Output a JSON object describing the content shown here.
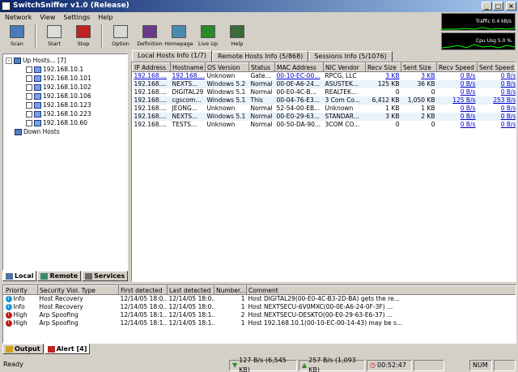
{
  "window": {
    "title": "SwitchSniffer v1.0 (Release)"
  },
  "menu": [
    "Network",
    "View",
    "Settings",
    "Help"
  ],
  "toolbar": [
    {
      "label": "Scan",
      "icon": "scan-icon",
      "color": "#4a7ab8"
    },
    {
      "label": "Start",
      "icon": "start-icon",
      "color": "#dcdcdc"
    },
    {
      "label": "Stop",
      "icon": "stop-icon",
      "color": "#c02020"
    },
    {
      "label": "Option",
      "icon": "option-icon",
      "color": "#d8d8d8"
    },
    {
      "label": "Definition",
      "icon": "definition-icon",
      "color": "#6a3a8a"
    },
    {
      "label": "Homepage",
      "icon": "homepage-icon",
      "color": "#4a8ab0"
    },
    {
      "label": "Live Up",
      "icon": "live-up-icon",
      "color": "#2a8a2a"
    },
    {
      "label": "Help",
      "icon": "help-icon",
      "color": "#3a6a3a"
    }
  ],
  "monitors": {
    "traffic": "Traffic 0.4 kB/s",
    "cpu": "Cpu Usg 5.0 %"
  },
  "tree": {
    "up_hosts": "Up Hosts... [7]",
    "hosts": [
      "192.168.10.1",
      "192.168.10.101",
      "192.168.10.102",
      "192.168.10.106",
      "192.168.10.123",
      "192.168.10.223",
      "192.168.10.60"
    ],
    "down_hosts": "Down Hosts"
  },
  "left_tabs": [
    "Local",
    "Remote",
    "Services"
  ],
  "right_tabs": [
    "Local Hosts Info (1/7)",
    "Remote Hosts Info (5/868)",
    "Sessions Info (5/1076)"
  ],
  "host_table": {
    "columns": [
      "IP Address",
      "Hostname",
      "OS Version",
      "Status",
      "MAC Address",
      "NIC Vendor",
      "Recv Size",
      "Sent Size",
      "Recv Speed",
      "Sent Speed"
    ],
    "rows": [
      [
        "192.168....",
        "192.168....",
        "Unknown",
        "Gate...",
        "00-10-EC-00...",
        "RPCG, LLC",
        "3 KB",
        "3 KB",
        "0 B/s",
        "0 B/s"
      ],
      [
        "192.168....",
        "NEXTS...",
        "Windows 5.2",
        "Normal",
        "00-0E-A6-24...",
        "ASUSTEK...",
        "125 KB",
        "36 KB",
        "0 B/s",
        "0 B/s"
      ],
      [
        "192.168....",
        "DIGITAL29",
        "Windows 5.1",
        "Normal",
        "00-E0-4C-B...",
        "REALTEK...",
        "0",
        "0",
        "0 B/s",
        "0 B/s"
      ],
      [
        "192.168....",
        "cgscom...",
        "Windows 5.1",
        "This",
        "00-04-76-E3...",
        "3 Com Co...",
        "6,412 KB",
        "1,050 KB",
        "125 B/s",
        "253 B/s"
      ],
      [
        "192.168....",
        "JEONG...",
        "Unknown",
        "Normal",
        "52-54-00-EB...",
        "Unknown",
        "1 KB",
        "1 KB",
        "0 B/s",
        "0 B/s"
      ],
      [
        "192.168....",
        "NEXTS...",
        "Windows 5.1",
        "Normal",
        "00-E0-29-63...",
        "STANDAR...",
        "3 KB",
        "2 KB",
        "0 B/s",
        "0 B/s"
      ],
      [
        "192.168....",
        "TESTS...",
        "Unknown",
        "Normal",
        "00-50-DA-90...",
        "3COM CO...",
        "0",
        "0",
        "0 B/s",
        "0 B/s"
      ]
    ]
  },
  "alert_table": {
    "columns": [
      "Priority",
      "Security Viol. Type",
      "First detected",
      "Last detected",
      "Number...",
      "Comment"
    ],
    "rows": [
      {
        "priority": "Info",
        "color": "#1a9ad8",
        "type": "Host Recovery",
        "first": "12/14/05 18:0...",
        "last": "12/14/05 18:0...",
        "number": "1",
        "comment": "Host DIGITAL29(00-E0-4C-B3-2D-BA) gets the re..."
      },
      {
        "priority": "Info",
        "color": "#1a9ad8",
        "type": "Host Recovery",
        "first": "12/14/05 18:0...",
        "last": "12/14/05 18:0...",
        "number": "1",
        "comment": "Host NEXTSECU-6V0MXC(00-0E-A6-24-0F-3F) ..."
      },
      {
        "priority": "High",
        "color": "#c01818",
        "type": "Arp Spoofing",
        "first": "12/14/05 18:1...",
        "last": "12/14/05 18:1...",
        "number": "2",
        "comment": "Host NEXTSECU-DESKTO(00-E0-29-63-E6-37) ..."
      },
      {
        "priority": "High",
        "color": "#c01818",
        "type": "Arp Spoofing",
        "first": "12/14/05 18:1...",
        "last": "12/14/05 18:1...",
        "number": "1",
        "comment": "Host 192.168.10.1(00-10-EC-00-14-43) may be s..."
      }
    ]
  },
  "bottom_tabs": [
    "Output",
    "Alert [4]"
  ],
  "status": {
    "ready": "Ready",
    "recv": "127 B/s (6,545 KB)",
    "sent": "257 B/s (1,093 KB)",
    "time": "00:52:47",
    "num": "NUM"
  }
}
